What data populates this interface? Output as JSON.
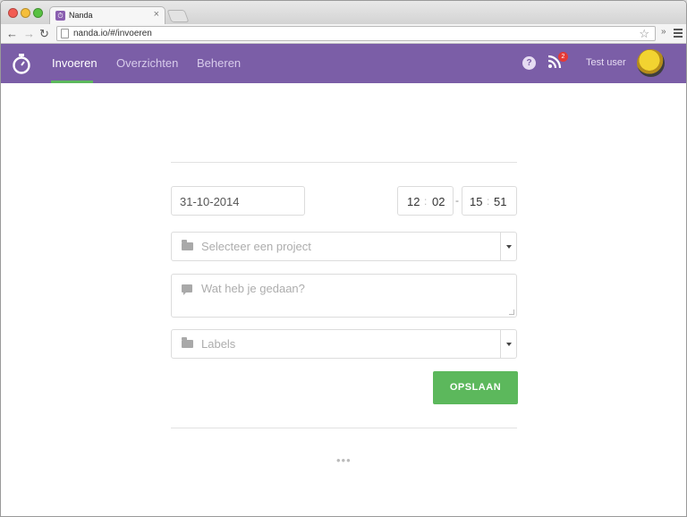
{
  "browser": {
    "tab_title": "Nanda",
    "tab_close": "×",
    "url": "nanda.io/#/invoeren",
    "ext_label": "»"
  },
  "header": {
    "nav": [
      {
        "label": "Invoeren",
        "active": true
      },
      {
        "label": "Overzichten",
        "active": false
      },
      {
        "label": "Beheren",
        "active": false
      }
    ],
    "help_glyph": "?",
    "notification_count": "2",
    "username": "Test user",
    "accent_color": "#7b5ea7"
  },
  "form": {
    "date": "31-10-2014",
    "start_time": {
      "hours": "12",
      "minutes": "02"
    },
    "end_time": {
      "hours": "15",
      "minutes": "51"
    },
    "time_separator": ":",
    "range_separator": "-",
    "project_placeholder": "Selecteer een project",
    "description_placeholder": "Wat heb je gedaan?",
    "labels_placeholder": "Labels",
    "save_label": "OPSLAAN",
    "save_color": "#5cb85c"
  },
  "footer": {
    "more": "•••"
  },
  "icons": [
    "stopwatch-icon",
    "help-icon",
    "rss-icon",
    "folder-icon",
    "comment-icon",
    "star-icon",
    "menu-icon"
  ]
}
